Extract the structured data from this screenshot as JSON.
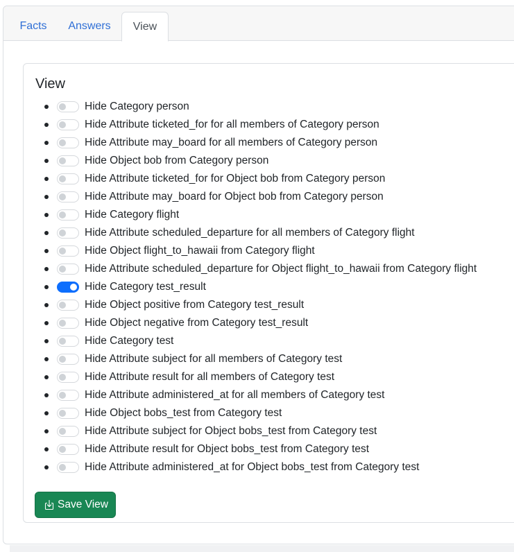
{
  "tabs": [
    {
      "label": "Facts",
      "active": false
    },
    {
      "label": "Answers",
      "active": false
    },
    {
      "label": "View",
      "active": true
    }
  ],
  "view": {
    "title": "View",
    "items": [
      {
        "label": "Hide Category person",
        "checked": false
      },
      {
        "label": "Hide Attribute ticketed_for for all members of Category person",
        "checked": false
      },
      {
        "label": "Hide Attribute may_board for all members of Category person",
        "checked": false
      },
      {
        "label": "Hide Object bob from Category person",
        "checked": false
      },
      {
        "label": "Hide Attribute ticketed_for for Object bob from Category person",
        "checked": false
      },
      {
        "label": "Hide Attribute may_board for Object bob from Category person",
        "checked": false
      },
      {
        "label": "Hide Category flight",
        "checked": false
      },
      {
        "label": "Hide Attribute scheduled_departure for all members of Category flight",
        "checked": false
      },
      {
        "label": "Hide Object flight_to_hawaii from Category flight",
        "checked": false
      },
      {
        "label": "Hide Attribute scheduled_departure for Object flight_to_hawaii from Category flight",
        "checked": false
      },
      {
        "label": "Hide Category test_result",
        "checked": true
      },
      {
        "label": "Hide Object positive from Category test_result",
        "checked": false
      },
      {
        "label": "Hide Object negative from Category test_result",
        "checked": false
      },
      {
        "label": "Hide Category test",
        "checked": false
      },
      {
        "label": "Hide Attribute subject for all members of Category test",
        "checked": false
      },
      {
        "label": "Hide Attribute result for all members of Category test",
        "checked": false
      },
      {
        "label": "Hide Attribute administered_at for all members of Category test",
        "checked": false
      },
      {
        "label": "Hide Object bobs_test from Category test",
        "checked": false
      },
      {
        "label": "Hide Attribute subject for Object bobs_test from Category test",
        "checked": false
      },
      {
        "label": "Hide Attribute result for Object bobs_test from Category test",
        "checked": false
      },
      {
        "label": "Hide Attribute administered_at for Object bobs_test from Category test",
        "checked": false
      }
    ],
    "save_button": {
      "label": "Save View",
      "icon": "download-icon"
    }
  },
  "colors": {
    "tab_link": "#2f6fd6",
    "switch_on": "#0d6efd",
    "save_button": "#198754"
  }
}
